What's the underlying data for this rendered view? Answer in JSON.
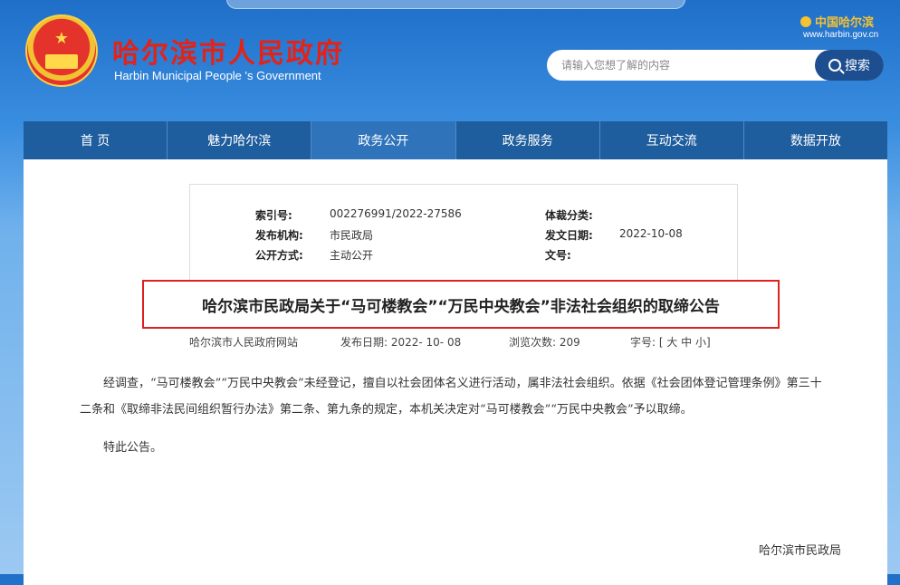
{
  "header": {
    "site_name_cn": "哈尔滨市人民政府",
    "site_name_en": "Harbin Municipal People 's Government",
    "brand_logo_text": "中国哈尔滨",
    "brand_url": "www.harbin.gov.cn",
    "search": {
      "placeholder": "请输入您想了解的内容",
      "button_label": "搜索"
    }
  },
  "nav": {
    "items": [
      {
        "label": "首 页"
      },
      {
        "label": "魅力哈尔滨"
      },
      {
        "label": "政务公开",
        "active": true
      },
      {
        "label": "政务服务"
      },
      {
        "label": "互动交流"
      },
      {
        "label": "数据开放"
      }
    ]
  },
  "meta": {
    "index_label": "索引号:",
    "index_value": "002276991/2022-27586",
    "genre_label": "体裁分类:",
    "genre_value": "",
    "org_label": "发布机构:",
    "org_value": "市民政局",
    "date_label": "发文日期:",
    "date_value": "2022-10-08",
    "mode_label": "公开方式:",
    "mode_value": "主动公开",
    "docno_label": "文号:",
    "docno_value": ""
  },
  "article": {
    "title": "哈尔滨市民政局关于“马可楼教会”“万民中央教会”非法社会组织的取缔公告",
    "source": "哈尔滨市人民政府网站",
    "publish_date": "发布日期:  2022- 10- 08",
    "views": "浏览次数:  209",
    "font_size": "字号: [ 大 中 小]",
    "paragraph1": "经调查，“马可楼教会”“万民中央教会”未经登记，擅自以社会团体名义进行活动，属非法社会组织。依据《社会团体登记管理条例》第三十二条和《取缔非法民间组织暂行办法》第二条、第九条的规定，本机关决定对“马可楼教会”“万民中央教会”予以取缔。",
    "paragraph2": "特此公告。",
    "signature": "哈尔滨市民政局"
  },
  "colors": {
    "nav_bg": "#1e5d9e",
    "nav_active": "#2f74bb",
    "title_border": "#e02020",
    "site_name": "#e2231a"
  }
}
